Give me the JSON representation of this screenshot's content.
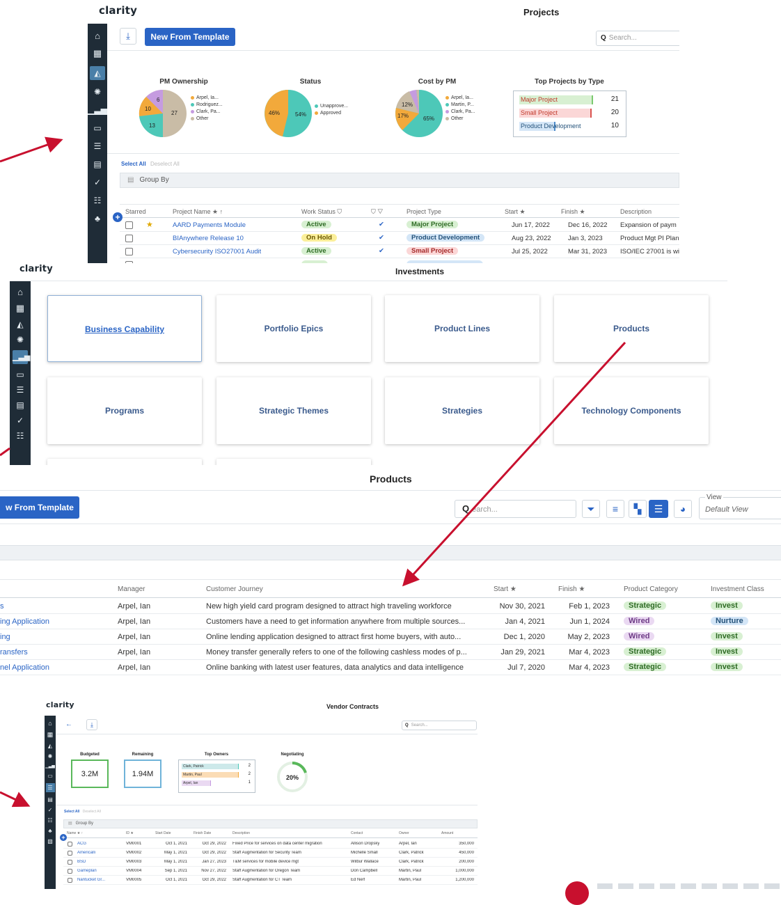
{
  "logo": "clarity",
  "projects": {
    "title": "Projects",
    "new_template": "New From Template",
    "search_placeholder": "Search...",
    "charts": {
      "pm_ownership": {
        "title": "PM Ownership",
        "legend": [
          "Arpel, Ia...",
          "Rodriguez...",
          "Clark, Pa...",
          "Other"
        ],
        "labels": [
          "6",
          "10",
          "13",
          "27"
        ]
      },
      "status": {
        "title": "Status",
        "legend": [
          "Unapprove...",
          "Approved"
        ],
        "labels": [
          "46%",
          "54%"
        ]
      },
      "cost_by_pm": {
        "title": "Cost by PM",
        "legend": [
          "Arpel, Ia...",
          "Martin, P...",
          "Clark, Pa...",
          "Other"
        ],
        "labels": [
          "12%",
          "17%",
          "65%"
        ]
      },
      "top_projects": {
        "title": "Top Projects by Type",
        "rows": [
          {
            "label": "Major Project",
            "value": "21"
          },
          {
            "label": "Small Project",
            "value": "20"
          },
          {
            "label": "Product Development",
            "value": "10"
          }
        ]
      }
    },
    "select_all": "Select All",
    "deselect_all": "Deselect All",
    "group_by": "Group By",
    "columns": [
      "Starred",
      "Project Name ★ ↑",
      "Work Status ⛉",
      "⛉ ▽",
      "Project Type",
      "Start ★",
      "Finish ★",
      "Description"
    ],
    "rows": [
      {
        "name": "AARD Payments Module",
        "status": "Active",
        "check": "✔",
        "type": "Major Project",
        "start": "Jun 17, 2022",
        "finish": "Dec 16, 2022",
        "desc": "Expansion of paym"
      },
      {
        "name": "BIAnywhere Release 10",
        "status": "On Hold",
        "check": "✔",
        "type": "Product Development",
        "start": "Aug 23, 2022",
        "finish": "Jan 3, 2023",
        "desc": "Product Mgt PI Plan"
      },
      {
        "name": "Cybersecurity ISO27001 Audit",
        "status": "Active",
        "check": "✔",
        "type": "Small Project",
        "start": "Jul 25, 2022",
        "finish": "Mar 31, 2023",
        "desc": "ISO/IEC 27001 is wi"
      }
    ]
  },
  "investments": {
    "title": "Investments",
    "cards": [
      "Business Capability",
      "Portfolio Epics",
      "Product Lines",
      "Products",
      "Programs",
      "Strategic Themes",
      "Strategies",
      "Technology Components"
    ]
  },
  "products": {
    "title": "Products",
    "new_template": "w From Template",
    "search_placeholder": "earch...",
    "view_label": "View",
    "view_value": "Default View",
    "columns": [
      "Manager",
      "Customer Journey",
      "Start ★",
      "Finish ★",
      "Product Category",
      "Investment Class"
    ],
    "rows": [
      {
        "name": "s",
        "manager": "Arpel, Ian",
        "journey": "New high yield card program designed to attract high traveling workforce",
        "start": "Nov 30, 2021",
        "finish": "Feb 1, 2023",
        "category": "Strategic",
        "class": "Invest"
      },
      {
        "name": "ing Application",
        "manager": "Arpel, Ian",
        "journey": "Customers have a need to get information anywhere from multiple sources...",
        "start": "Jan 4, 2021",
        "finish": "Jun 1, 2024",
        "category": "Wired",
        "class": "Nurture"
      },
      {
        "name": "ing",
        "manager": "Arpel, Ian",
        "journey": "Online lending application designed to attract first home buyers, with auto...",
        "start": "Dec 1, 2020",
        "finish": "May 2, 2023",
        "category": "Wired",
        "class": "Invest"
      },
      {
        "name": "ransfers",
        "manager": "Arpel, Ian",
        "journey": "Money transfer generally refers to one of the following cashless modes of p...",
        "start": "Jan 29, 2021",
        "finish": "Mar 4, 2023",
        "category": "Strategic",
        "class": "Invest"
      },
      {
        "name": "nel Application",
        "manager": "Arpel, Ian",
        "journey": "Online banking with latest user features, data analytics and data intelligence",
        "start": "Jul 7, 2020",
        "finish": "Mar 4, 2023",
        "category": "Strategic",
        "class": "Invest"
      }
    ]
  },
  "vendor": {
    "title": "Vendor Contracts",
    "search_placeholder": "Search...",
    "kpis": {
      "budgeted_label": "Budgeted",
      "budgeted_value": "3.2M",
      "remaining_label": "Remaining",
      "remaining_value": "1.94M",
      "owners_label": "Top Owners",
      "negotiating_label": "Negotiating",
      "negotiating_value": "20%"
    },
    "owners": [
      {
        "label": "Clark, Patrick",
        "value": "2"
      },
      {
        "label": "Martin, Paul",
        "value": "2"
      },
      {
        "label": "Arpel, Ian",
        "value": "1"
      }
    ],
    "select_all": "Select All",
    "deselect_all": "Deselect All",
    "group_by": "Group By",
    "columns": [
      "Name ★ ↑",
      "ID ★",
      "Start Date",
      "Finish Date",
      "Description",
      "Contact",
      "Owner",
      "Amount"
    ],
    "rows": [
      {
        "name": "ACG",
        "id": "VM0001",
        "start": "Oct 1, 2021",
        "finish": "Oct 29, 2022",
        "desc": "Fixed Price for services on data center migration",
        "contact": "Allison Dropsky",
        "owner": "Arpel, Ian",
        "amount": "350,000"
      },
      {
        "name": "Americalli",
        "id": "VM0002",
        "start": "May 1, 2021",
        "finish": "Oct 29, 2022",
        "desc": "Staff Augmentation for Security Team",
        "contact": "Michelle Small",
        "owner": "Clark, Patrick",
        "amount": "450,000"
      },
      {
        "name": "BSD",
        "id": "VM0003",
        "start": "May 1, 2021",
        "finish": "Jan 27, 2023",
        "desc": "T&M services for mobile device mgt",
        "contact": "Wilbur Wallace",
        "owner": "Clark, Patrick",
        "amount": "200,000"
      },
      {
        "name": "Gameplan",
        "id": "VM0004",
        "start": "Sep 1, 2021",
        "finish": "Nov 27, 2022",
        "desc": "Staff Augmentation for Oregon Team",
        "contact": "Don Campbell",
        "owner": "Martin, Paul",
        "amount": "1,000,000"
      },
      {
        "name": "Nantucket Gr...",
        "id": "VM0005",
        "start": "Oct 1, 2021",
        "finish": "Oct 29, 2022",
        "desc": "Staff Augmentation for CT Team",
        "contact": "Ed Nerf",
        "owner": "Martin, Paul",
        "amount": "1,200,000"
      }
    ]
  },
  "colors": {
    "rail": "#1f2c37",
    "primary": "#2a64c5",
    "arrow": "#c8102e",
    "teal": "#4dc8b8",
    "tan": "#c9bca6",
    "orange": "#f2a93b",
    "purple": "#c59be0"
  }
}
